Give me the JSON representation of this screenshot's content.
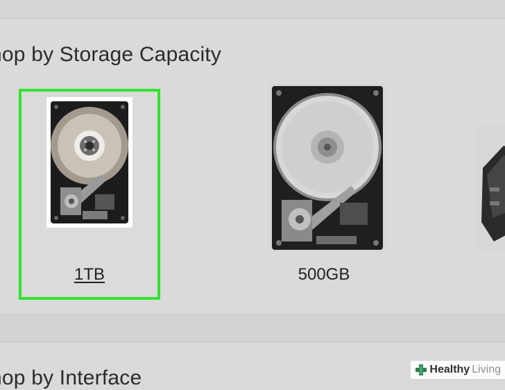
{
  "sections": [
    {
      "title": "hop by Storage Capacity",
      "products": [
        {
          "label": "1TB",
          "image": "hard-drive-image",
          "selected": true
        },
        {
          "label": "500GB",
          "image": "hard-drive-image",
          "selected": false
        },
        {
          "label": "",
          "image": "hard-drive-image",
          "selected": false
        }
      ]
    },
    {
      "title": "hop by Interface"
    }
  ],
  "watermark": {
    "brand_bold": "Healthy",
    "brand_light": "Living",
    "icon": "plus-cross-icon"
  },
  "colors": {
    "highlight_border": "#31e42e",
    "panel_bg": "#dadada",
    "text": "#2b2b2b"
  }
}
